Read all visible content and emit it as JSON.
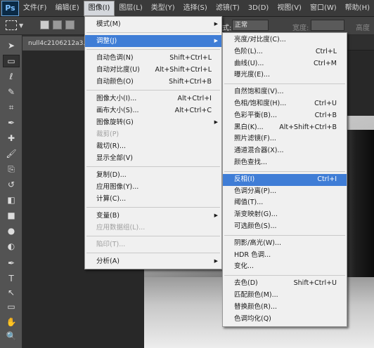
{
  "app": {
    "logo": "Ps"
  },
  "menubar": [
    "文件(F)",
    "编辑(E)",
    "图像(I)",
    "图层(L)",
    "类型(Y)",
    "选择(S)",
    "滤镜(T)",
    "3D(D)",
    "视图(V)",
    "窗口(W)",
    "帮助(H)"
  ],
  "options": {
    "style_label": "式:",
    "style_value": "正常",
    "width_label": "宽度:",
    "height_label": "高度"
  },
  "document": {
    "tab": "null4c2106212a3..."
  },
  "image_menu": [
    {
      "label": "模式(M)",
      "submenu": true
    },
    {
      "sep": true
    },
    {
      "label": "调整(J)",
      "submenu": true,
      "highlighted": true
    },
    {
      "sep": true
    },
    {
      "label": "自动色调(N)",
      "shortcut": "Shift+Ctrl+L"
    },
    {
      "label": "自动对比度(U)",
      "shortcut": "Alt+Shift+Ctrl+L"
    },
    {
      "label": "自动颜色(O)",
      "shortcut": "Shift+Ctrl+B"
    },
    {
      "sep": true
    },
    {
      "label": "图像大小(I)...",
      "shortcut": "Alt+Ctrl+I"
    },
    {
      "label": "画布大小(S)...",
      "shortcut": "Alt+Ctrl+C"
    },
    {
      "label": "图像旋转(G)",
      "submenu": true
    },
    {
      "label": "裁剪(P)",
      "disabled": true
    },
    {
      "label": "裁切(R)..."
    },
    {
      "label": "显示全部(V)"
    },
    {
      "sep": true
    },
    {
      "label": "复制(D)..."
    },
    {
      "label": "应用图像(Y)..."
    },
    {
      "label": "计算(C)..."
    },
    {
      "sep": true
    },
    {
      "label": "变量(B)",
      "submenu": true
    },
    {
      "label": "应用数据组(L)...",
      "disabled": true
    },
    {
      "sep": true
    },
    {
      "label": "陷印(T)...",
      "disabled": true
    },
    {
      "sep": true
    },
    {
      "label": "分析(A)",
      "submenu": true
    }
  ],
  "adjust_menu": [
    {
      "label": "亮度/对比度(C)..."
    },
    {
      "label": "色阶(L)...",
      "shortcut": "Ctrl+L"
    },
    {
      "label": "曲线(U)...",
      "shortcut": "Ctrl+M"
    },
    {
      "label": "曝光度(E)..."
    },
    {
      "sep": true
    },
    {
      "label": "自然饱和度(V)..."
    },
    {
      "label": "色相/饱和度(H)...",
      "shortcut": "Ctrl+U"
    },
    {
      "label": "色彩平衡(B)...",
      "shortcut": "Ctrl+B"
    },
    {
      "label": "黑白(K)...",
      "shortcut": "Alt+Shift+Ctrl+B"
    },
    {
      "label": "照片滤镜(F)..."
    },
    {
      "label": "通道混合器(X)..."
    },
    {
      "label": "颜色查找..."
    },
    {
      "sep": true
    },
    {
      "label": "反相(I)",
      "shortcut": "Ctrl+I",
      "highlighted": true
    },
    {
      "label": "色调分离(P)..."
    },
    {
      "label": "阈值(T)..."
    },
    {
      "label": "渐变映射(G)..."
    },
    {
      "label": "可选颜色(S)..."
    },
    {
      "sep": true
    },
    {
      "label": "阴影/高光(W)..."
    },
    {
      "label": "HDR 色调..."
    },
    {
      "label": "变化..."
    },
    {
      "sep": true
    },
    {
      "label": "去色(D)",
      "shortcut": "Shift+Ctrl+U"
    },
    {
      "label": "匹配颜色(M)..."
    },
    {
      "label": "替换颜色(R)..."
    },
    {
      "label": "色调均化(Q)"
    }
  ],
  "tools": [
    "move-icon",
    "marquee-icon",
    "lasso-icon",
    "quick-select-icon",
    "crop-icon",
    "eyedropper-icon",
    "healing-brush-icon",
    "brush-icon",
    "clone-stamp-icon",
    "history-brush-icon",
    "eraser-icon",
    "gradient-icon",
    "blur-icon",
    "dodge-icon",
    "pen-icon",
    "type-icon",
    "path-select-icon",
    "rectangle-icon",
    "hand-icon",
    "zoom-icon"
  ],
  "colors": {
    "highlight": "#3f7dd6",
    "menu_bg": "#f0f0f0",
    "workspace": "#282828"
  }
}
